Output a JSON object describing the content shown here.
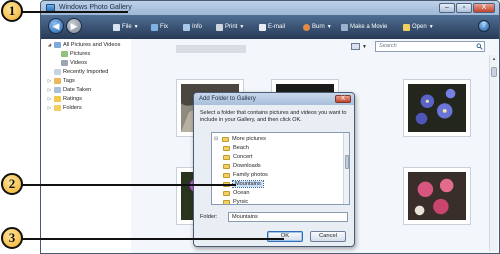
{
  "window": {
    "title": "Windows Photo Gallery",
    "controls": [
      "–",
      "▫",
      "X"
    ]
  },
  "toolbar": {
    "items": [
      {
        "label": "File",
        "icon": "file-icon",
        "dropdown": true
      },
      {
        "label": "Fix",
        "icon": "fix-icon",
        "dropdown": false
      },
      {
        "label": "Info",
        "icon": "info-icon",
        "dropdown": false
      },
      {
        "label": "Print",
        "icon": "print-icon",
        "dropdown": true
      },
      {
        "label": "E-mail",
        "icon": "email-icon",
        "dropdown": false
      },
      {
        "label": "Burn",
        "icon": "burn-icon",
        "dropdown": true
      },
      {
        "label": "Make a Movie",
        "icon": "movie-icon",
        "dropdown": false
      },
      {
        "label": "Open",
        "icon": "open-icon",
        "dropdown": true
      }
    ],
    "help_label": "?"
  },
  "sidebar": {
    "items": [
      {
        "label": "All Pictures and Videos",
        "expander": "◢",
        "icon": "gallery-icon"
      },
      {
        "label": "Pictures",
        "expander": "",
        "icon": "pictures-icon"
      },
      {
        "label": "Videos",
        "expander": "",
        "icon": "videos-icon"
      },
      {
        "label": "Recently Imported",
        "expander": "",
        "icon": "recent-icon"
      },
      {
        "label": "Tags",
        "expander": "▷",
        "icon": "tags-icon"
      },
      {
        "label": "Date Taken",
        "expander": "▷",
        "icon": "calendar-icon"
      },
      {
        "label": "Ratings",
        "expander": "▷",
        "icon": "star-icon"
      },
      {
        "label": "Folders",
        "expander": "▷",
        "icon": "folder-icon"
      }
    ]
  },
  "search": {
    "placeholder": "Search"
  },
  "dialog": {
    "title": "Add Folder to Gallery",
    "close_label": "X",
    "instructions": "Select a folder that contains pictures and videos you want to include in your Gallery, and then click OK.",
    "folders": [
      {
        "label": "More pictures",
        "level": 0,
        "expander": "⊟",
        "selected": false
      },
      {
        "label": "Beach",
        "level": 1,
        "expander": "",
        "selected": false
      },
      {
        "label": "Concert",
        "level": 1,
        "expander": "",
        "selected": false
      },
      {
        "label": "Downloads",
        "level": 1,
        "expander": "",
        "selected": false
      },
      {
        "label": "Family photos",
        "level": 1,
        "expander": "",
        "selected": false
      },
      {
        "label": "Mountains",
        "level": 1,
        "expander": "",
        "selected": true
      },
      {
        "label": "Ocean",
        "level": 1,
        "expander": "",
        "selected": false
      },
      {
        "label": "Pyrsic",
        "level": 1,
        "expander": "",
        "selected": false
      }
    ],
    "folder_label": "Folder:",
    "folder_value": "Mountains",
    "ok_label": "OK",
    "cancel_label": "Cancel"
  },
  "callouts": [
    "1",
    "2",
    "3"
  ]
}
